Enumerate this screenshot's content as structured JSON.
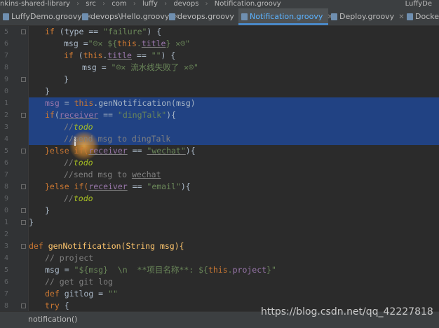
{
  "breadcrumb": [
    "nkins-shared-library",
    "src",
    "com",
    "luffy",
    "devops",
    "Notification.groovy"
  ],
  "breadcrumb_right": "LuffyDe",
  "tabs": [
    {
      "label": "LuffyDemo.groovy"
    },
    {
      "label": "devops\\Hello.groovy"
    },
    {
      "label": "devops.groovy"
    },
    {
      "label": "Notification.groovy",
      "active": true
    },
    {
      "label": "Deploy.groovy"
    },
    {
      "label": "Docker.gr"
    }
  ],
  "line_numbers": [
    "5",
    "6",
    "7",
    "8",
    "9",
    "0",
    "1",
    "2",
    "3",
    "4",
    "5",
    "6",
    "7",
    "8",
    "9",
    "0",
    "1",
    "2",
    "3",
    "4",
    "5",
    "6",
    "7",
    "8"
  ],
  "code": {
    "l1": {
      "a": "if",
      "b": " (type == ",
      "c": "\"failure\"",
      "d": ") {"
    },
    "l2": {
      "a": "msg =",
      "b": "\"☹✕ ${",
      "c": "this",
      "d": ".",
      "e": "title",
      "f": "} ✕☹\""
    },
    "l3": {
      "a": "if",
      "b": " (",
      "c": "this",
      "d": ".",
      "e": "title",
      "f": " == ",
      "g": "\"\"",
      "h": ") {"
    },
    "l4": {
      "a": "msg = ",
      "b": "\"☹✕ 流水线失败了 ✕☹\""
    },
    "l5": {
      "a": "}"
    },
    "l6": {
      "a": "}"
    },
    "l7": {
      "a": "msg",
      "b": " = ",
      "c": "this",
      "d": ".genNotification(msg)"
    },
    "l8": {
      "a": "if",
      "b": "(",
      "c": "receiver",
      "d": " == ",
      "e": "\"dingTalk\"",
      "f": "){"
    },
    "l9": {
      "a": "//",
      "b": "todo"
    },
    "l10": {
      "a": "//send msg to dingTalk"
    },
    "l11": {
      "a": "}else if(",
      "b": "receiver",
      "c": " == ",
      "d": "\"wechat\"",
      "e": "){"
    },
    "l12": {
      "a": "//",
      "b": "todo"
    },
    "l13": {
      "a": "//send msg to ",
      "b": "wechat"
    },
    "l14": {
      "a": "}else if(",
      "b": "receiver",
      "c": " == ",
      "d": "\"email\"",
      "e": "){"
    },
    "l15": {
      "a": "//",
      "b": "todo"
    },
    "l16": {
      "a": "}"
    },
    "l17": {
      "a": "}"
    },
    "l18": {
      "a": "def",
      "b": " genNotification(String msg){"
    },
    "l19": {
      "a": "// project"
    },
    "l20": {
      "a": "msg = ",
      "b": "\"${msg}  \\n  **项目名称**: ${",
      "c": "this",
      "d": ".",
      "e": "project",
      "f": "}\""
    },
    "l21": {
      "a": "// get git log"
    },
    "l22": {
      "a": "def",
      "b": " gitlog = ",
      "c": "\"\""
    },
    "l23": {
      "a": "try",
      "b": " {"
    }
  },
  "status": {
    "crumb": "notification()"
  },
  "watermark": "https://blog.csdn.net/qq_42227818"
}
